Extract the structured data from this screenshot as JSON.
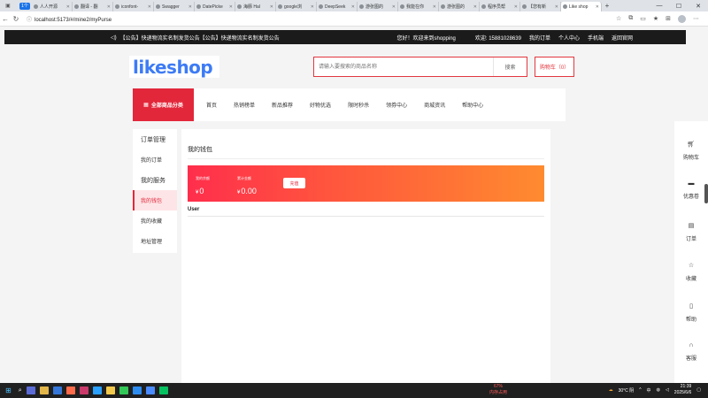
{
  "browser": {
    "workspace_badge": "1个",
    "tabs": [
      {
        "title": "人人开源"
      },
      {
        "title": "翻译 - 翻"
      },
      {
        "title": "iconfont-"
      },
      {
        "title": "Swagger"
      },
      {
        "title": "DatePicke"
      },
      {
        "title": "海豚 Hal"
      },
      {
        "title": "google浏"
      },
      {
        "title": "DeepSeek"
      },
      {
        "title": "游张图的"
      },
      {
        "title": "我能在你"
      },
      {
        "title": "游张图的"
      },
      {
        "title": "程序员帮"
      },
      {
        "title": "【您有新"
      },
      {
        "title": "Like shop"
      }
    ],
    "url": "localhost:5173/#/mine2/myPurse"
  },
  "notice": {
    "announcement": "【公告】快递物流实名制发货公告【公告】快递物流实名制发货公告",
    "welcome": "您好！欢迎来到shopping",
    "links": [
      "欢迎: 15881028639",
      "我的订单",
      "个人中心",
      "手机端",
      "返回官网"
    ]
  },
  "header": {
    "logo": "likeshop",
    "search_placeholder": "请输入要搜索的商品名称",
    "search_button": "搜索",
    "cart": "购物车（0）"
  },
  "nav": {
    "all_categories": "全部商品分类",
    "items": [
      "首页",
      "热销榜单",
      "新品推荐",
      "好物优选",
      "限时秒杀",
      "领券中心",
      "商城资讯",
      "帮助中心"
    ]
  },
  "left_menu": {
    "order_title": "订单管理",
    "my_orders": "我的订单",
    "service_title": "我的服务",
    "wallet": "我的钱包",
    "favorites": "我的收藏",
    "address": "地址管理"
  },
  "content": {
    "title": "我的钱包",
    "balance_label": "我的余额",
    "balance_currency": "¥",
    "balance_value": "0",
    "total_label": "累计金额",
    "total_currency": "¥",
    "total_value": "0.00",
    "recharge_button": "充值",
    "user_label": "User"
  },
  "right_sidebar": {
    "items": [
      {
        "label": "购物车",
        "icon": "cart-icon"
      },
      {
        "label": "优惠卷",
        "icon": "coupon-icon"
      },
      {
        "label": "订单",
        "icon": "order-icon"
      },
      {
        "label": "收藏",
        "icon": "star-icon"
      },
      {
        "label": "帮助",
        "icon": "help-icon"
      },
      {
        "label": "客服",
        "icon": "headset-icon"
      }
    ]
  },
  "taskbar": {
    "memory_percent": "67%",
    "memory_label": "内存占用",
    "weather": "30°C 阴",
    "lang": "中",
    "time": "21:39",
    "date": "2025/6/6"
  },
  "colors": {
    "brand_red": "#e3273a",
    "logo_blue": "#3d7bf5",
    "wallet_gradient_start": "#ff2e4c",
    "wallet_gradient_end": "#ff8b2f"
  }
}
